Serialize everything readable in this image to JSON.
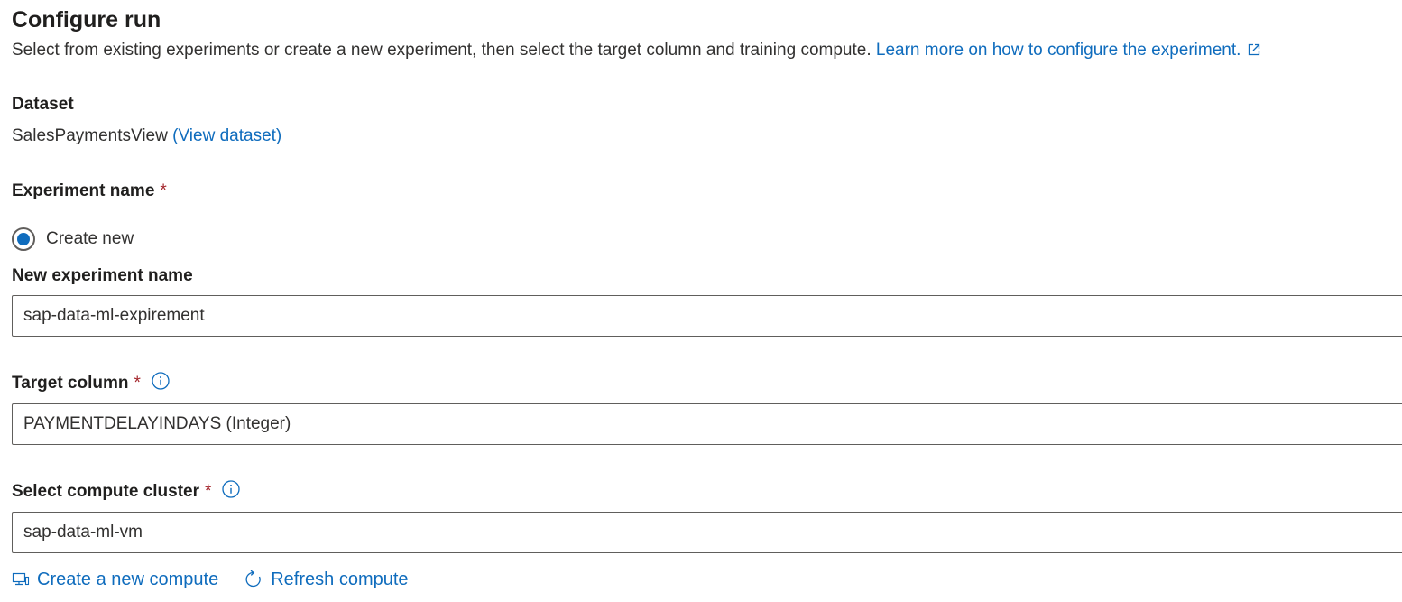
{
  "header": {
    "title": "Configure run",
    "description": "Select from existing experiments or create a new experiment, then select the target column and training compute.",
    "learn_more_link": "Learn more on how to configure the experiment."
  },
  "dataset": {
    "label": "Dataset",
    "name": "SalesPaymentsView",
    "view_link": "(View dataset)"
  },
  "experiment": {
    "label": "Experiment name",
    "required_mark": "*",
    "option_create_new": "Create new",
    "option_selected": true,
    "new_name_label": "New experiment name",
    "new_name_value": "sap-data-ml-expirement"
  },
  "target_column": {
    "label": "Target column",
    "required_mark": "*",
    "value": "PAYMENTDELAYINDAYS (Integer)"
  },
  "compute": {
    "label": "Select compute cluster",
    "required_mark": "*",
    "value": "sap-data-ml-vm",
    "create_new_label": "Create a new compute",
    "refresh_label": "Refresh compute"
  },
  "icons": {
    "external_link": "external-link-icon",
    "info": "info-icon",
    "compute": "computer-icon",
    "refresh": "refresh-icon"
  },
  "colors": {
    "accent": "#0f6cbd",
    "required": "#a4262c",
    "text": "#201f1e",
    "border": "#605e5c"
  }
}
